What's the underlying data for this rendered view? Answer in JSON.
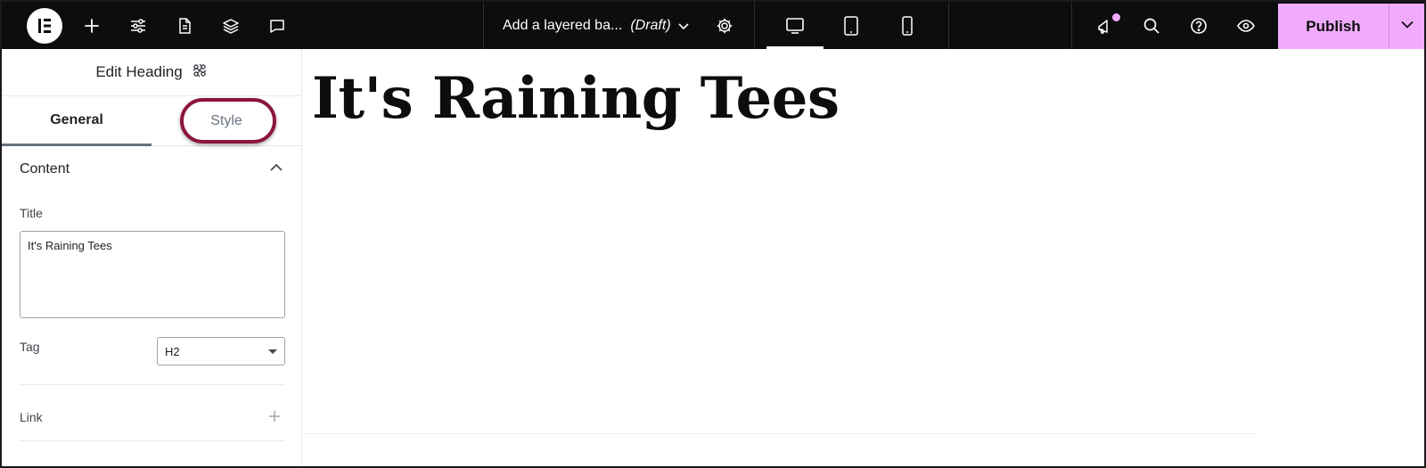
{
  "topbar": {
    "document_title": "Add a layered ba...",
    "document_status": "(Draft)",
    "publish_label": "Publish",
    "icons": [
      "elementor-logo-icon",
      "plus-icon",
      "sliders-icon",
      "page-icon",
      "layers-icon",
      "comment-icon",
      "chevron-down-icon",
      "gear-icon",
      "desktop-icon",
      "tablet-icon",
      "mobile-icon",
      "megaphone-icon",
      "search-icon",
      "help-icon",
      "eye-icon"
    ],
    "active_device": "desktop",
    "accent_color": "#f0abfc"
  },
  "panel": {
    "header_title": "Edit Heading",
    "tabs": [
      {
        "label": "General",
        "active": true
      },
      {
        "label": "Style",
        "active": false,
        "highlighted": true
      }
    ],
    "highlight_color": "#8b1538",
    "content_section": {
      "title": "Content",
      "expanded": true,
      "title_label": "Title",
      "title_value": "It's Raining Tees",
      "tag_label": "Tag",
      "tag_value": "H2",
      "link_label": "Link"
    }
  },
  "canvas": {
    "heading_text": "It's Raining Tees"
  }
}
